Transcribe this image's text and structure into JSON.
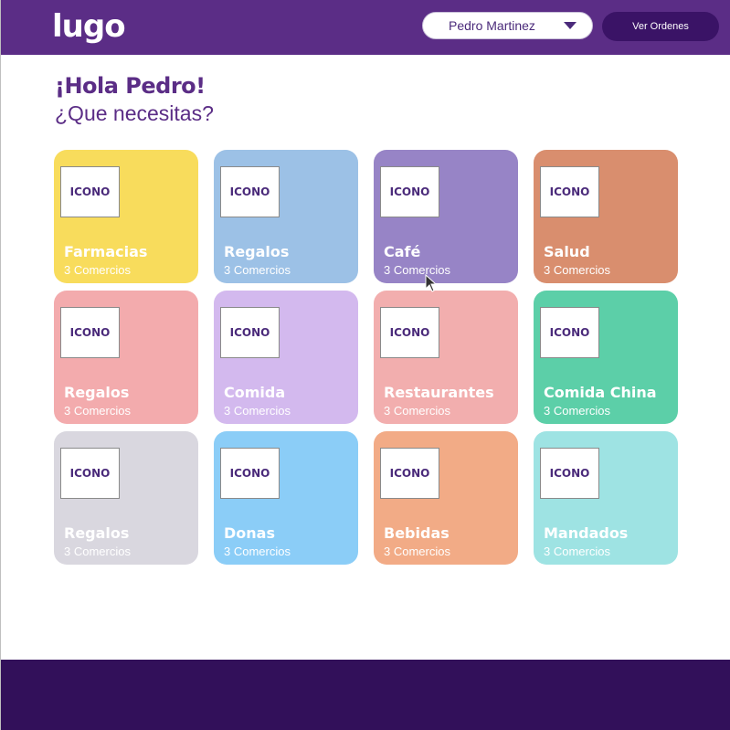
{
  "header": {
    "logo": "lugo",
    "user_name": "Pedro Martinez",
    "orders_button": "Ver Ordenes",
    "background": "#5b2d86"
  },
  "main": {
    "greeting": "¡Hola Pedro!",
    "question": "¿Que necesitas?"
  },
  "categories": [
    {
      "title": "Farmacias",
      "subtitle": "3 Comercios",
      "icon": "ICONO",
      "color": "#f8dc5c"
    },
    {
      "title": "Regalos",
      "subtitle": "3 Comercios",
      "icon": "ICONO",
      "color": "#9cc1e6"
    },
    {
      "title": "Café",
      "subtitle": "3 Comercios",
      "icon": "ICONO",
      "color": "#9784c6"
    },
    {
      "title": "Salud",
      "subtitle": "3 Comercios",
      "icon": "ICONO",
      "color": "#d98e6e"
    },
    {
      "title": "Regalos",
      "subtitle": "3 Comercios",
      "icon": "ICONO",
      "color": "#f3abad"
    },
    {
      "title": "Comida",
      "subtitle": "3 Comercios",
      "icon": "ICONO",
      "color": "#d3b9ee"
    },
    {
      "title": "Restaurantes",
      "subtitle": "3 Comercios",
      "icon": "ICONO",
      "color": "#f2aeae"
    },
    {
      "title": "Comida China",
      "subtitle": "3 Comercios",
      "icon": "ICONO",
      "color": "#5ccfa8"
    },
    {
      "title": "Regalos",
      "subtitle": "3 Comercios",
      "icon": "ICONO",
      "color": "#d9d7df"
    },
    {
      "title": "Donas",
      "subtitle": "3 Comercios",
      "icon": "ICONO",
      "color": "#8bcdf7"
    },
    {
      "title": "Bebidas",
      "subtitle": "3 Comercios",
      "icon": "ICONO",
      "color": "#f2ab86"
    },
    {
      "title": "Mandados",
      "subtitle": "3 Comercios",
      "icon": "ICONO",
      "color": "#9ee3e3"
    }
  ],
  "footer": {
    "background": "#32105a"
  }
}
